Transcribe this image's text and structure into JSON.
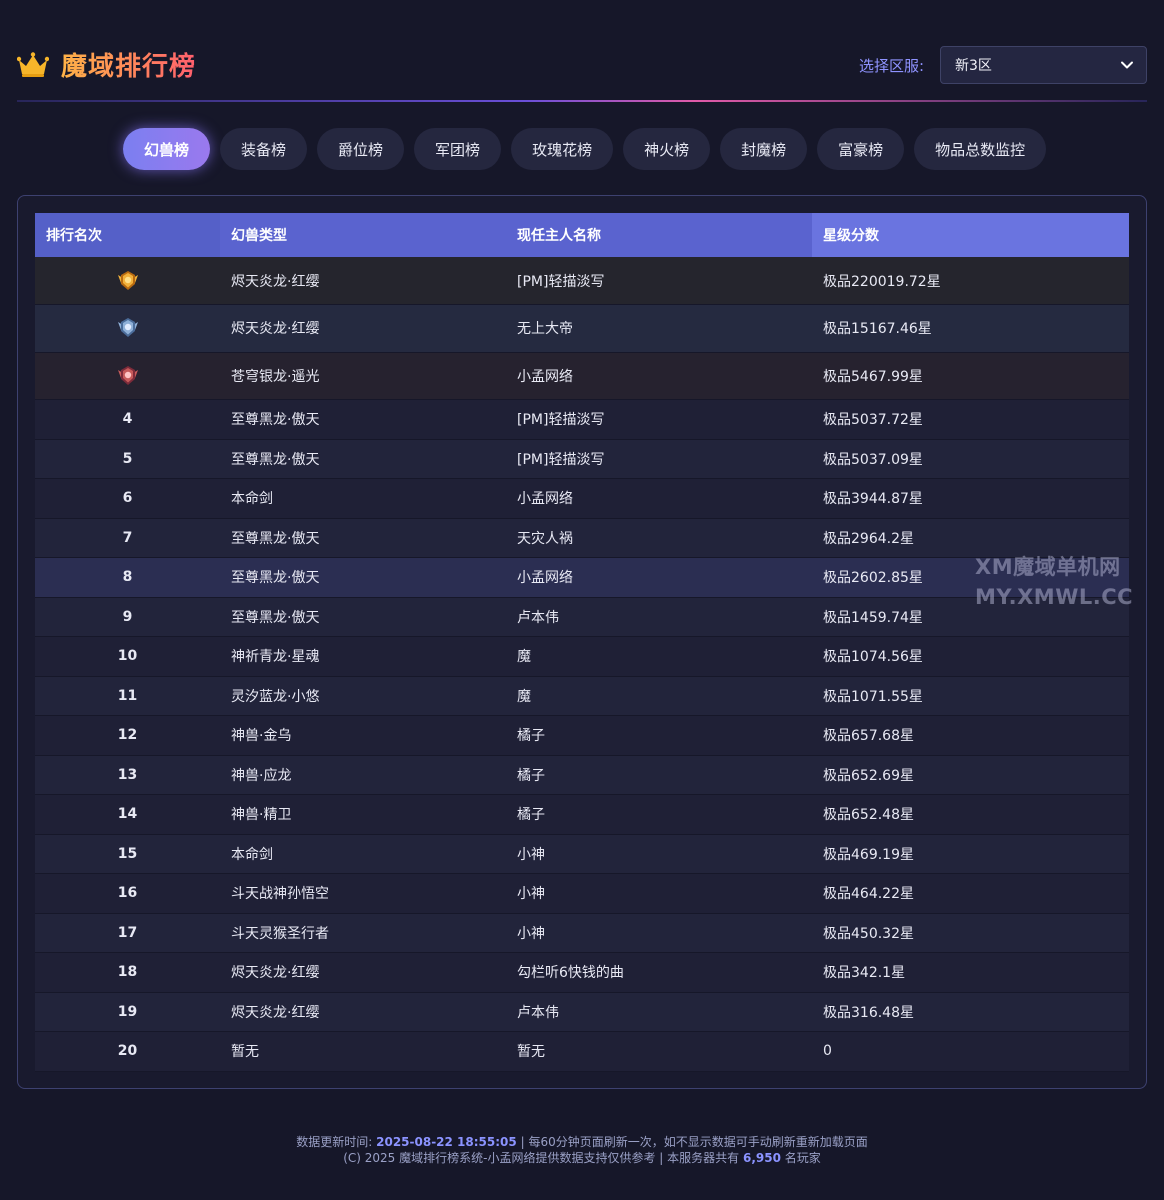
{
  "header": {
    "title": "魔域排行榜",
    "server_label": "选择区服:",
    "server_value": "新3区"
  },
  "tabs": [
    {
      "label": "幻兽榜",
      "active": true
    },
    {
      "label": "装备榜",
      "active": false
    },
    {
      "label": "爵位榜",
      "active": false
    },
    {
      "label": "军团榜",
      "active": false
    },
    {
      "label": "玫瑰花榜",
      "active": false
    },
    {
      "label": "神火榜",
      "active": false
    },
    {
      "label": "封魔榜",
      "active": false
    },
    {
      "label": "富豪榜",
      "active": false
    },
    {
      "label": "物品总数监控",
      "active": false
    }
  ],
  "table": {
    "columns": [
      "排行名次",
      "幻兽类型",
      "现任主人名称",
      "星级分数"
    ],
    "rows": [
      {
        "rank": "1",
        "medal": "gold-medal-icon",
        "type": "烬天炎龙·红缨",
        "owner": "[PM]轻描淡写",
        "score": "极品220019.72星"
      },
      {
        "rank": "2",
        "medal": "silver-medal-icon",
        "type": "烬天炎龙·红缨",
        "owner": "无上大帝",
        "score": "极品15167.46星"
      },
      {
        "rank": "3",
        "medal": "bronze-medal-icon",
        "type": "苍穹银龙·遥光",
        "owner": "小孟网络",
        "score": "极品5467.99星"
      },
      {
        "rank": "4",
        "type": "至尊黑龙·傲天",
        "owner": "[PM]轻描淡写",
        "score": "极品5037.72星"
      },
      {
        "rank": "5",
        "type": "至尊黑龙·傲天",
        "owner": "[PM]轻描淡写",
        "score": "极品5037.09星"
      },
      {
        "rank": "6",
        "type": "本命剑",
        "owner": "小孟网络",
        "score": "极品3944.87星"
      },
      {
        "rank": "7",
        "type": "至尊黑龙·傲天",
        "owner": "天灾人祸",
        "score": "极品2964.2星"
      },
      {
        "rank": "8",
        "type": "至尊黑龙·傲天",
        "owner": "小孟网络",
        "score": "极品2602.85星"
      },
      {
        "rank": "9",
        "type": "至尊黑龙·傲天",
        "owner": "卢本伟",
        "score": "极品1459.74星"
      },
      {
        "rank": "10",
        "type": "神祈青龙·星魂",
        "owner": "魔",
        "score": "极品1074.56星"
      },
      {
        "rank": "11",
        "type": "灵汐蓝龙·小悠",
        "owner": "魔",
        "score": "极品1071.55星"
      },
      {
        "rank": "12",
        "type": "神兽·金乌",
        "owner": "橘子",
        "score": "极品657.68星"
      },
      {
        "rank": "13",
        "type": "神兽·应龙",
        "owner": "橘子",
        "score": "极品652.69星"
      },
      {
        "rank": "14",
        "type": "神兽·精卫",
        "owner": "橘子",
        "score": "极品652.48星"
      },
      {
        "rank": "15",
        "type": "本命剑",
        "owner": "小神",
        "score": "极品469.19星"
      },
      {
        "rank": "16",
        "type": "斗天战神孙悟空",
        "owner": "小神",
        "score": "极品464.22星"
      },
      {
        "rank": "17",
        "type": "斗天灵猴圣行者",
        "owner": "小神",
        "score": "极品450.32星"
      },
      {
        "rank": "18",
        "type": "烬天炎龙·红缨",
        "owner": "勾栏听6快钱的曲",
        "score": "极品342.1星"
      },
      {
        "rank": "19",
        "type": "烬天炎龙·红缨",
        "owner": "卢本伟",
        "score": "极品316.48星"
      },
      {
        "rank": "20",
        "type": "暂无",
        "owner": "暂无",
        "score": "0"
      }
    ]
  },
  "watermark": {
    "line1": "XM魔域单机网",
    "line2": "MY.XMWL.CC"
  },
  "footer": {
    "update_label": "数据更新时间:",
    "update_time": "2025-08-22 18:55:05",
    "update_note": "| 每60分钟页面刷新一次，如不显示数据可手动刷新重新加载页面",
    "copyright": "(C) 2025 魔域排行榜系统-小孟网络提供数据支持仅供参考 | 本服务器共有",
    "player_count": "6,950",
    "player_suffix": "名玩家"
  },
  "colors": {
    "background": "#161729",
    "accent": "#7b7ff0",
    "header_row": "#5a63cf",
    "title_gradient": [
      "#ffb347",
      "#ff5f6d"
    ]
  }
}
